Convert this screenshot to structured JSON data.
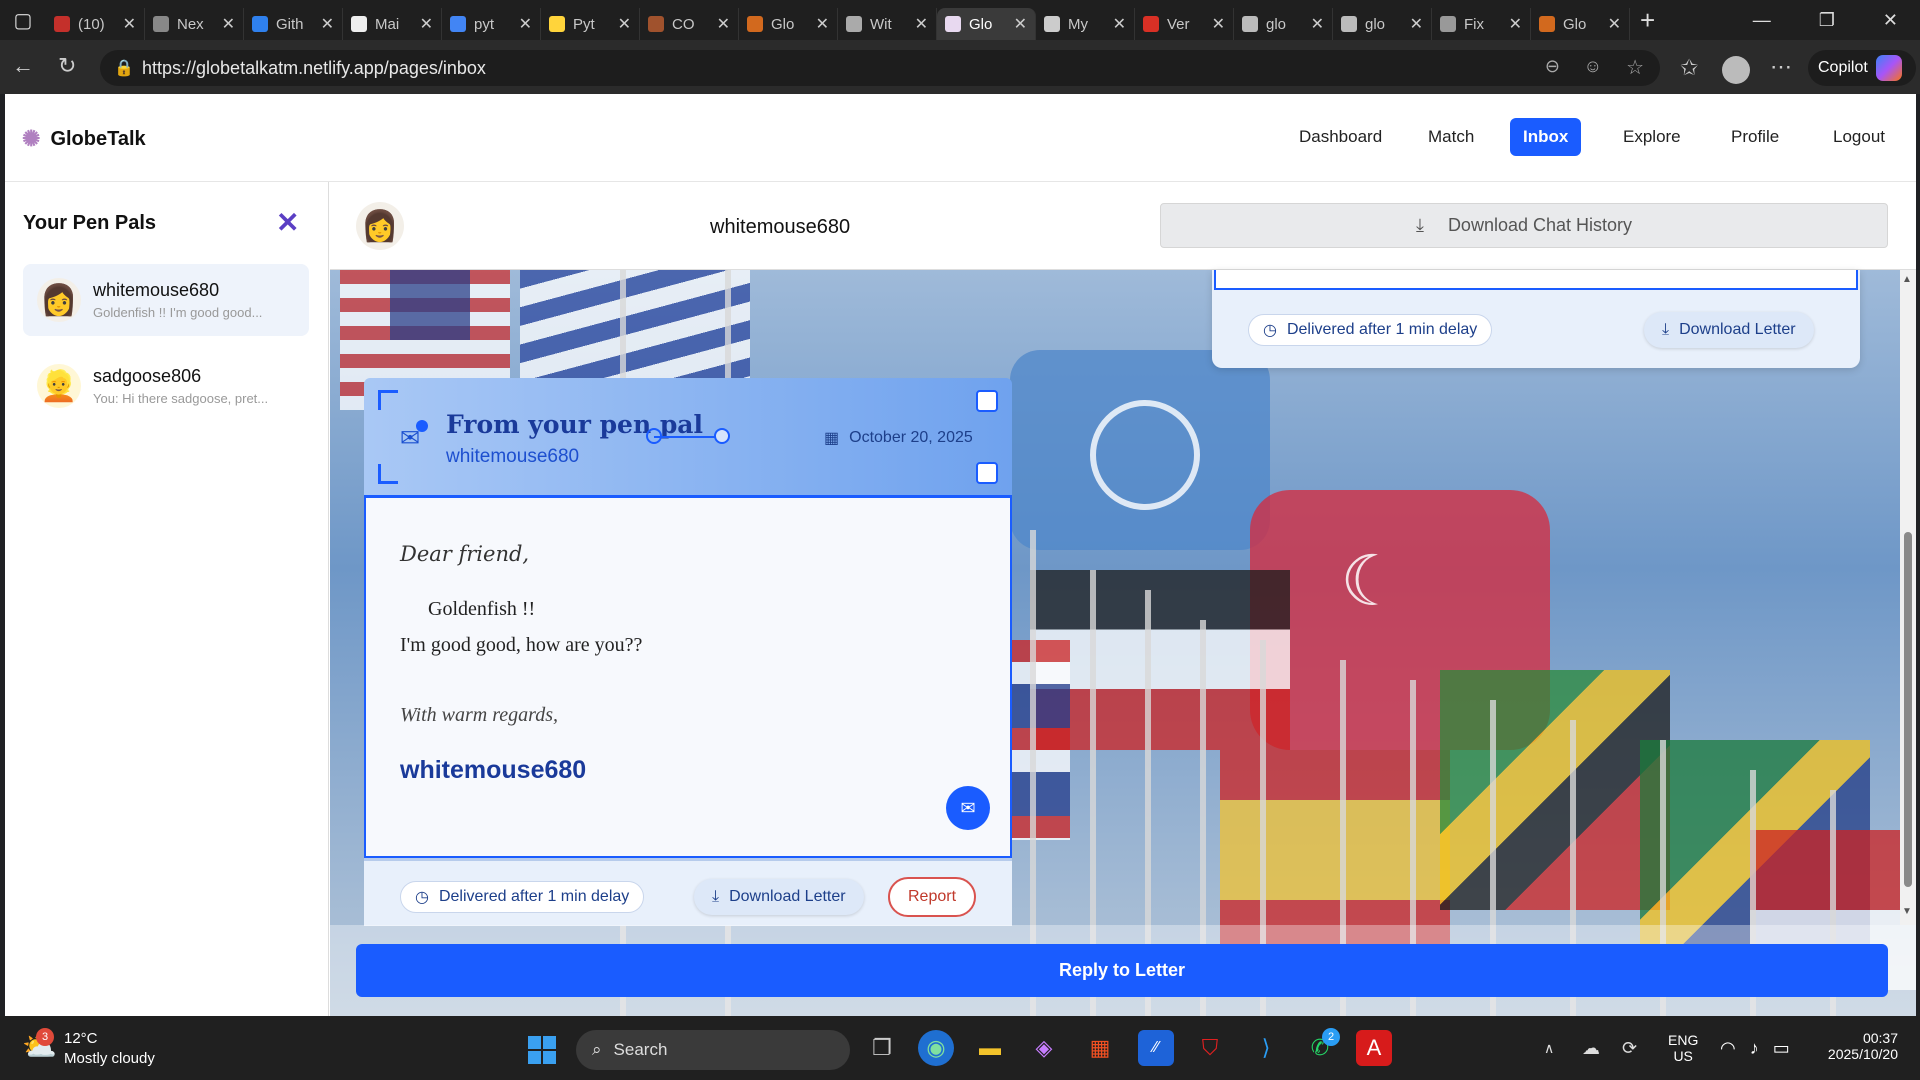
{
  "browser": {
    "tabs": [
      {
        "title": "(10)",
        "color": "#c4302b"
      },
      {
        "title": "Nex",
        "color": "#888888"
      },
      {
        "title": "Gith",
        "color": "#2f80ed"
      },
      {
        "title": "Mai",
        "color": "#eeeeee"
      },
      {
        "title": "pyt",
        "color": "#4285f4"
      },
      {
        "title": "Pyt",
        "color": "#ffd43b"
      },
      {
        "title": "CO",
        "color": "#a0522d"
      },
      {
        "title": "Glo",
        "color": "#d2691e"
      },
      {
        "title": "Wit",
        "color": "#aaaaaa"
      },
      {
        "title": "Glo",
        "color": "#e8d9f0",
        "active": true
      },
      {
        "title": "My",
        "color": "#cccccc"
      },
      {
        "title": "Ver",
        "color": "#d93025"
      },
      {
        "title": "glo",
        "color": "#bbbbbb"
      },
      {
        "title": "glo",
        "color": "#bbbbbb"
      },
      {
        "title": "Fix",
        "color": "#999999"
      },
      {
        "title": "Glo",
        "color": "#d2691e"
      }
    ],
    "url": "https://globetalkatm.netlify.app/pages/inbox",
    "copilot_label": "Copilot"
  },
  "nav": {
    "brand": "GlobeTalk",
    "items": [
      "Dashboard",
      "Match",
      "Inbox",
      "Explore",
      "Profile",
      "Logout"
    ],
    "active": "Inbox"
  },
  "sidebar": {
    "title": "Your Pen Pals",
    "pals": [
      {
        "name": "whitemouse680",
        "preview": "Goldenfish !! I'm good good...",
        "active": true
      },
      {
        "name": "sadgoose806",
        "preview": "You: Hi there sadgoose, pret..."
      }
    ]
  },
  "chat": {
    "partner": "whitemouse680",
    "download_history_label": "Download Chat History",
    "reply_label": "Reply to Letter"
  },
  "prev_card": {
    "delivery": "Delivered after 1 min delay",
    "download_label": "Download Letter"
  },
  "letter": {
    "header_title": "From your pen pal",
    "sender": "whitemouse680",
    "date": "October 20, 2025",
    "greeting": "Dear friend,",
    "line1": "Goldenfish !!",
    "line2": "I'm good good, how are you??",
    "closing": "With warm regards,",
    "signature": "whitemouse680",
    "delivery": "Delivered after 1 min delay",
    "download_label": "Download Letter",
    "report_label": "Report"
  },
  "taskbar": {
    "weather_temp": "12°C",
    "weather_desc": "Mostly cloudy",
    "weather_badge": "3",
    "search_label": "Search",
    "lang_line1": "ENG",
    "lang_line2": "US",
    "time": "00:37",
    "date": "2025/10/20",
    "whatsapp_badge": "2"
  },
  "colors": {
    "accent": "#1a5cff",
    "report": "#d9534f"
  }
}
